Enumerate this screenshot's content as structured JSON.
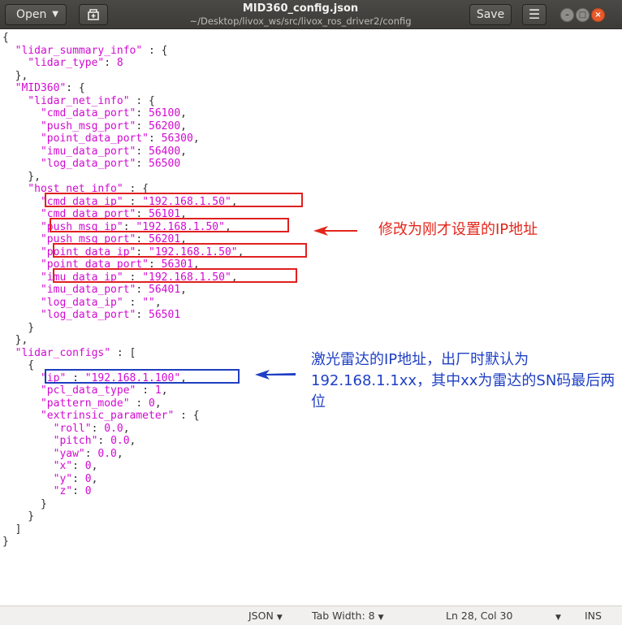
{
  "window": {
    "title": "MID360_config.json",
    "path": "~/Desktop/livox_ws/src/livox_ros_driver2/config"
  },
  "toolbar": {
    "open_label": "Open",
    "save_label": "Save"
  },
  "editor": {
    "lines": [
      [
        [
          "p",
          "{"
        ]
      ],
      [
        [
          "k",
          "  \"lidar_summary_info\""
        ],
        [
          "p",
          " : {"
        ]
      ],
      [
        [
          "k",
          "    \"lidar_type\""
        ],
        [
          "p",
          ": "
        ],
        [
          "n",
          "8"
        ]
      ],
      [
        [
          "p",
          "  },"
        ]
      ],
      [
        [
          "k",
          "  \"MID360\""
        ],
        [
          "p",
          ": {"
        ]
      ],
      [
        [
          "k",
          "    \"lidar_net_info\""
        ],
        [
          "p",
          " : {"
        ]
      ],
      [
        [
          "k",
          "      \"cmd_data_port\""
        ],
        [
          "p",
          ": "
        ],
        [
          "n",
          "56100"
        ],
        [
          "p",
          ","
        ]
      ],
      [
        [
          "k",
          "      \"push_msg_port\""
        ],
        [
          "p",
          ": "
        ],
        [
          "n",
          "56200"
        ],
        [
          "p",
          ","
        ]
      ],
      [
        [
          "k",
          "      \"point_data_port\""
        ],
        [
          "p",
          ": "
        ],
        [
          "n",
          "56300"
        ],
        [
          "p",
          ","
        ]
      ],
      [
        [
          "k",
          "      \"imu_data_port\""
        ],
        [
          "p",
          ": "
        ],
        [
          "n",
          "56400"
        ],
        [
          "p",
          ","
        ]
      ],
      [
        [
          "k",
          "      \"log_data_port\""
        ],
        [
          "p",
          ": "
        ],
        [
          "n",
          "56500"
        ]
      ],
      [
        [
          "p",
          "    },"
        ]
      ],
      [
        [
          "k",
          "    \"host_net_info\""
        ],
        [
          "p",
          " : {"
        ]
      ],
      [
        [
          "k",
          "      \"cmd_data_ip\""
        ],
        [
          "p",
          " : "
        ],
        [
          "s",
          "\"192.168.1.50\""
        ],
        [
          "p",
          ","
        ]
      ],
      [
        [
          "k",
          "      \"cmd_data_port\""
        ],
        [
          "p",
          ": "
        ],
        [
          "n",
          "56101"
        ],
        [
          "p",
          ","
        ]
      ],
      [
        [
          "k",
          "      \"push_msg_ip\""
        ],
        [
          "p",
          ": "
        ],
        [
          "s",
          "\"192.168.1.50\""
        ],
        [
          "p",
          ","
        ]
      ],
      [
        [
          "k",
          "      \"push_msg_port\""
        ],
        [
          "p",
          ": "
        ],
        [
          "n",
          "56201"
        ],
        [
          "p",
          ","
        ]
      ],
      [
        [
          "k",
          "      \"point_data_ip\""
        ],
        [
          "p",
          ": "
        ],
        [
          "s",
          "\"192.168.1.50\""
        ],
        [
          "p",
          ","
        ]
      ],
      [
        [
          "k",
          "      \"point_data_port\""
        ],
        [
          "p",
          ": "
        ],
        [
          "n",
          "56301"
        ],
        [
          "p",
          ","
        ]
      ],
      [
        [
          "k",
          "      \"imu_data_ip\""
        ],
        [
          "p",
          " : "
        ],
        [
          "s",
          "\"192.168.1.50\""
        ],
        [
          "p",
          ","
        ]
      ],
      [
        [
          "k",
          "      \"imu_data_port\""
        ],
        [
          "p",
          ": "
        ],
        [
          "n",
          "56401"
        ],
        [
          "p",
          ","
        ]
      ],
      [
        [
          "k",
          "      \"log_data_ip\""
        ],
        [
          "p",
          " : "
        ],
        [
          "s",
          "\"\""
        ],
        [
          "p",
          ","
        ]
      ],
      [
        [
          "k",
          "      \"log_data_port\""
        ],
        [
          "p",
          ": "
        ],
        [
          "n",
          "56501"
        ]
      ],
      [
        [
          "p",
          "    }"
        ]
      ],
      [
        [
          "p",
          "  },"
        ]
      ],
      [
        [
          "k",
          "  \"lidar_configs\""
        ],
        [
          "p",
          " : ["
        ]
      ],
      [
        [
          "p",
          "    {"
        ]
      ],
      [
        [
          "k",
          "      \"ip\""
        ],
        [
          "p",
          " : "
        ],
        [
          "s",
          "\"192.168.1.100\""
        ],
        [
          "p",
          ","
        ]
      ],
      [
        [
          "k",
          "      \"pcl_data_type\""
        ],
        [
          "p",
          " : "
        ],
        [
          "n",
          "1"
        ],
        [
          "p",
          ","
        ]
      ],
      [
        [
          "k",
          "      \"pattern_mode\""
        ],
        [
          "p",
          " : "
        ],
        [
          "n",
          "0"
        ],
        [
          "p",
          ","
        ]
      ],
      [
        [
          "k",
          "      \"extrinsic_parameter\""
        ],
        [
          "p",
          " : {"
        ]
      ],
      [
        [
          "k",
          "        \"roll\""
        ],
        [
          "p",
          ": "
        ],
        [
          "n",
          "0.0"
        ],
        [
          "p",
          ","
        ]
      ],
      [
        [
          "k",
          "        \"pitch\""
        ],
        [
          "p",
          ": "
        ],
        [
          "n",
          "0.0"
        ],
        [
          "p",
          ","
        ]
      ],
      [
        [
          "k",
          "        \"yaw\""
        ],
        [
          "p",
          ": "
        ],
        [
          "n",
          "0.0"
        ],
        [
          "p",
          ","
        ]
      ],
      [
        [
          "k",
          "        \"x\""
        ],
        [
          "p",
          ": "
        ],
        [
          "n",
          "0"
        ],
        [
          "p",
          ","
        ]
      ],
      [
        [
          "k",
          "        \"y\""
        ],
        [
          "p",
          ": "
        ],
        [
          "n",
          "0"
        ],
        [
          "p",
          ","
        ]
      ],
      [
        [
          "k",
          "        \"z\""
        ],
        [
          "p",
          ": "
        ],
        [
          "n",
          "0"
        ]
      ],
      [
        [
          "p",
          "      }"
        ]
      ],
      [
        [
          "p",
          "    }"
        ]
      ],
      [
        [
          "p",
          "  ]"
        ]
      ],
      [
        [
          "p",
          "}"
        ]
      ]
    ]
  },
  "annotations": {
    "red_note": "修改为刚才设置的IP地址",
    "blue_note": "激光雷达的IP地址，出厂时默认为192.168.1.1xx，其中xx为雷达的SN码最后两位",
    "red_color": "#e3261b",
    "blue_color": "#1f3fc4"
  },
  "statusbar": {
    "language": "JSON",
    "tab_width": "Tab Width: 8",
    "position": "Ln 28, Col 30",
    "mode": "INS"
  },
  "icons": {
    "open_caret": "caret-down-icon",
    "new_tab": "new-tab-icon",
    "menu": "hamburger-menu-icon",
    "minimize": "minimize-icon",
    "maximize": "maximize-icon",
    "close": "close-icon"
  }
}
